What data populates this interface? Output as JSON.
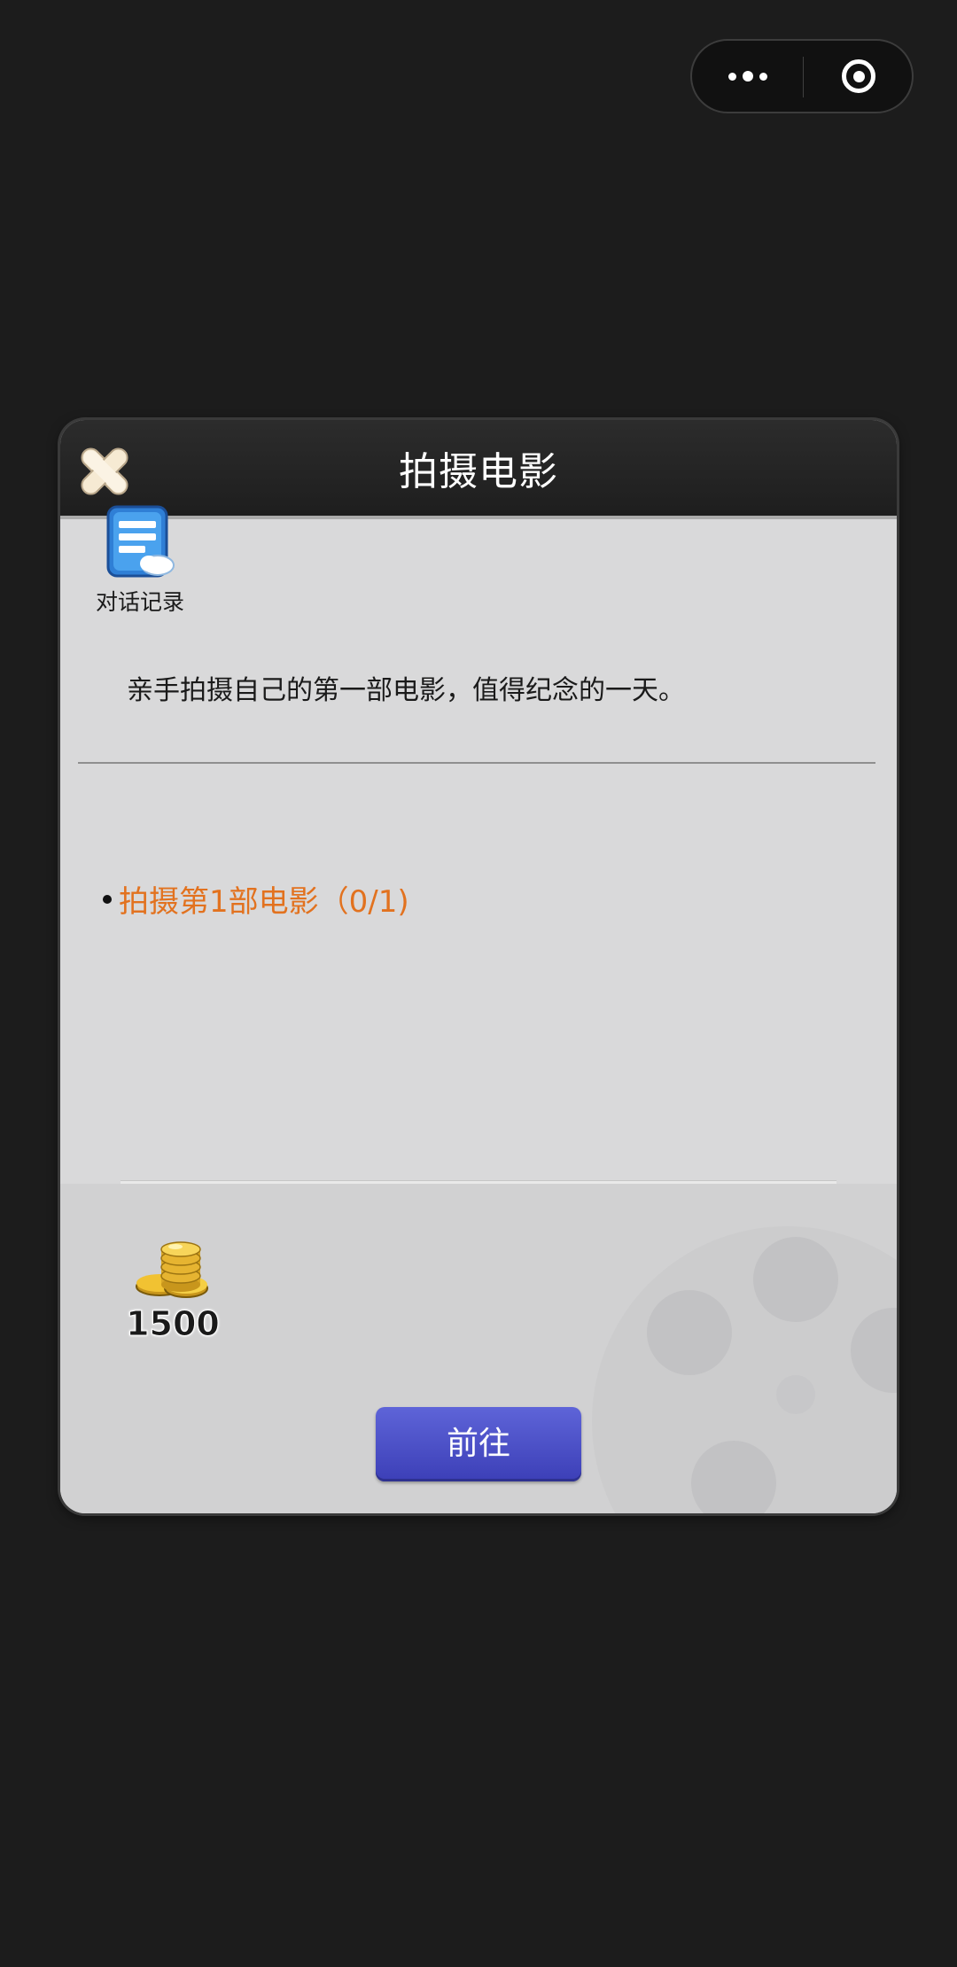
{
  "capsule": {
    "more_icon": "more-dots-icon",
    "close_icon": "target-circle-icon"
  },
  "dialog": {
    "title": "拍摄电影",
    "close_icon": "close-x-icon",
    "history": {
      "icon": "chat-log-icon",
      "label": "对话记录"
    },
    "description": "亲手拍摄自己的第一部电影，值得纪念的一天。",
    "task": {
      "text": "拍摄第1部电影（0/1)",
      "color": "#e2721f"
    },
    "reward": {
      "icon": "gold-coins-icon",
      "amount": "1500"
    },
    "go_button_label": "前往"
  },
  "colors": {
    "background": "#1c1c1c",
    "dialog_body": "#d9d9da",
    "header": "#1e1e1e",
    "button": "#4a4ec8"
  }
}
